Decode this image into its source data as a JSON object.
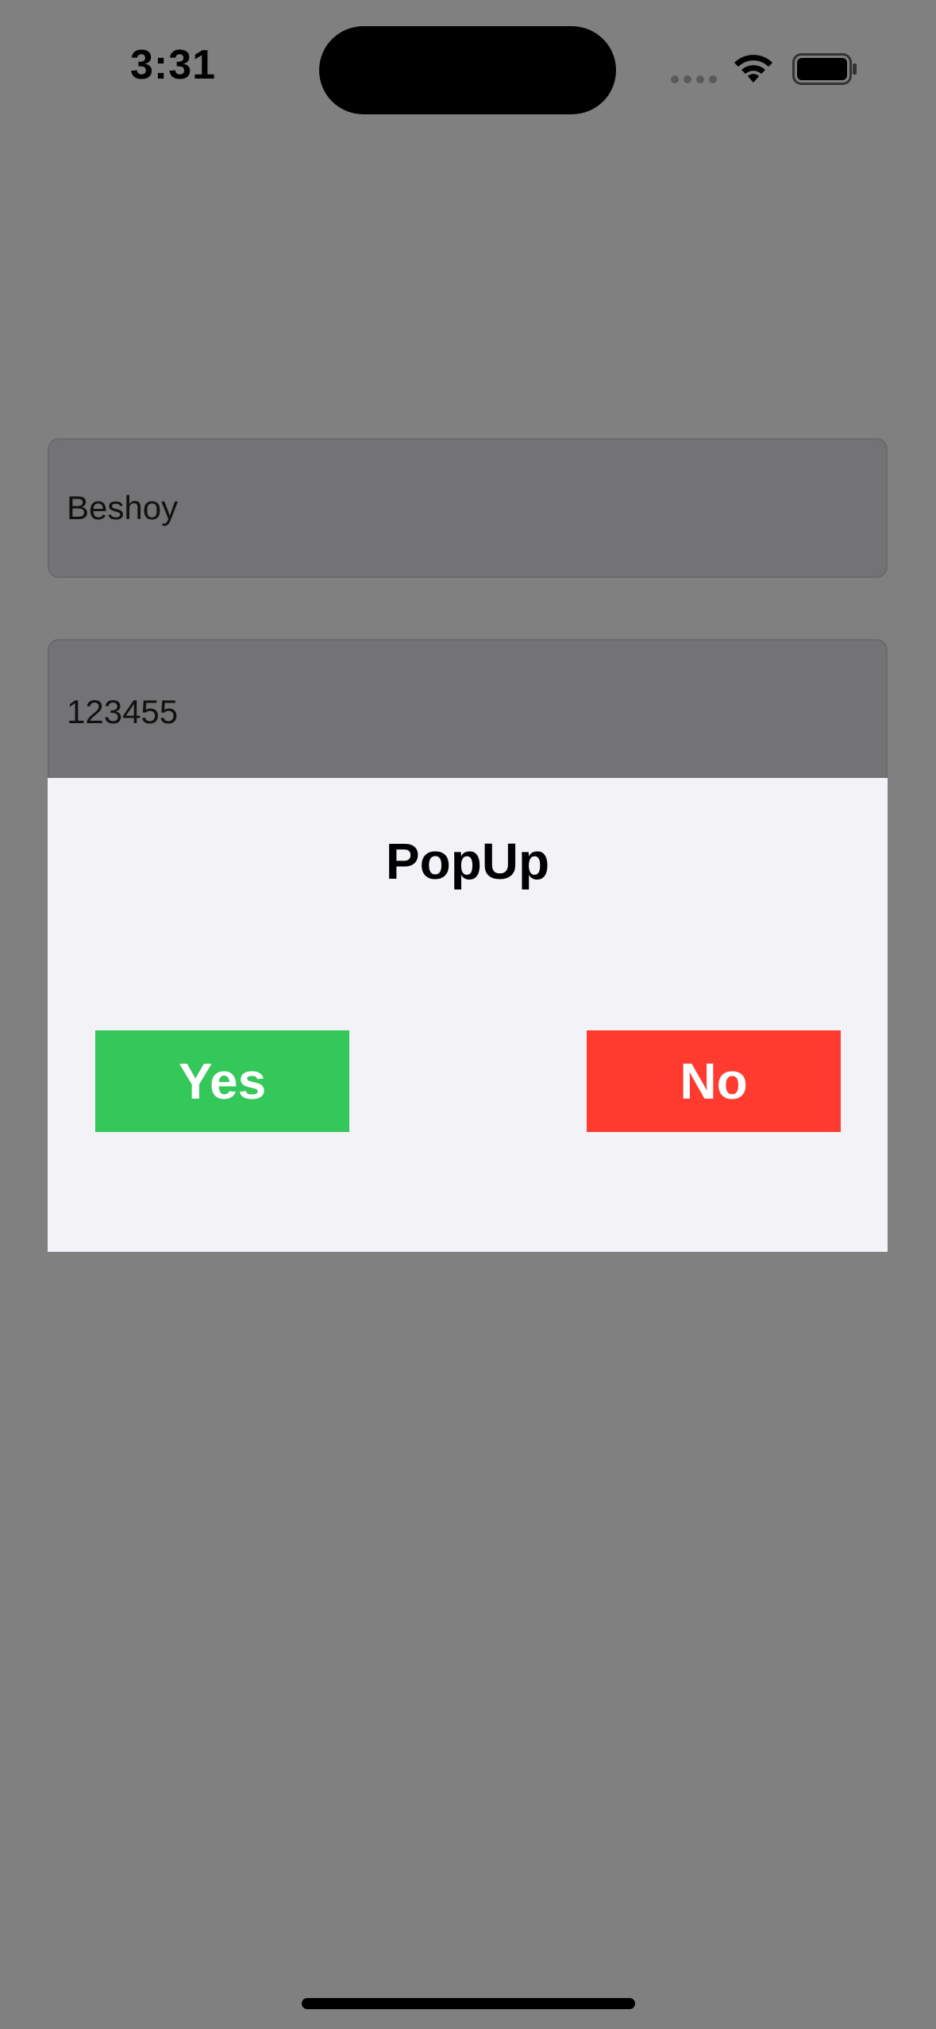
{
  "status_bar": {
    "time": "3:31",
    "icons": [
      "signal-dots-icon",
      "wifi-icon",
      "battery-icon"
    ]
  },
  "form": {
    "username_value": "Beshoy",
    "password_value": "123455"
  },
  "popup": {
    "title": "PopUp",
    "yes_label": "Yes",
    "no_label": "No"
  },
  "colors": {
    "overlay_background": "#808080",
    "popup_background": "#f2f2f7",
    "yes_button": "#34c759",
    "no_button": "#ff3b30"
  }
}
